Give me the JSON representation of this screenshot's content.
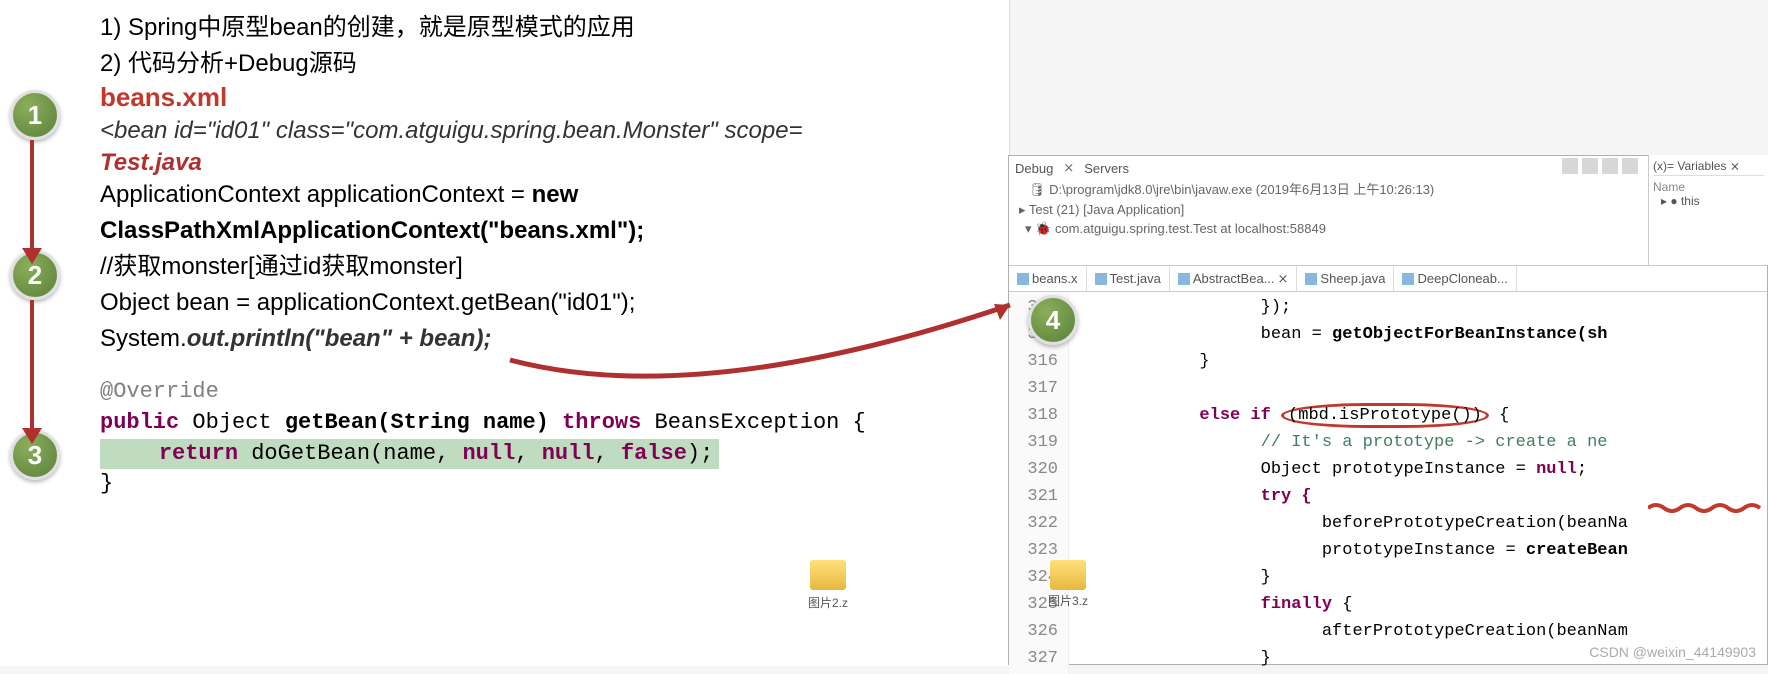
{
  "intro": {
    "line1": "1)  Spring中原型bean的创建，就是原型模式的应用",
    "line2": "2)  代码分析+Debug源码"
  },
  "beans_xml": {
    "title": "beans.xml",
    "content_prefix": "<bean id=",
    "id_val": "\"id01\"",
    "class_attr": " class=",
    "class_val": "\"com.atguigu.spring.bean.Monster\"",
    "scope_attr": " scope=",
    "scope_cut": "\"......\""
  },
  "test_java": {
    "title": "Test.java",
    "line1_a": "ApplicationContext  applicationContext = ",
    "line1_b": "new",
    "line2": "ClassPathXmlApplicationContext(\"beans.xml\");",
    "comment": "//获取monster[通过id获取monster]",
    "line3": "Object bean = applicationContext.getBean(\"id01\");",
    "line4a": "System.",
    "line4b": "out.println(\"bean\" + bean);"
  },
  "getbean": {
    "anno": "@Override",
    "sig_public": "public",
    "sig_obj": " Object ",
    "sig_name": "getBean(String name)",
    "sig_throws": " throws ",
    "sig_exc": "BeansException {",
    "ret_kw": "return",
    "ret_call": " doGetBean(name, ",
    "ret_null1": "null",
    "ret_c1": ", ",
    "ret_null2": "null",
    "ret_c2": ", ",
    "ret_false": "false",
    "ret_end": ");",
    "close": "}"
  },
  "badges": {
    "1": "1",
    "2": "2",
    "3": "3",
    "4": "4"
  },
  "debug": {
    "tab_debug": "Debug",
    "tab_servers": "Servers",
    "proc": "D:\\program\\jdk8.0\\jre\\bin\\javaw.exe (2019年6月13日 上午10:26:13)",
    "app": "Test (21) [Java Application]",
    "thread": "com.atguigu.spring.test.Test at localhost:58849"
  },
  "ftabs": {
    "beans": "beans.x",
    "test": "Test.java",
    "abstract": "AbstractBea...",
    "sheep": "Sheep.java",
    "deep": "DeepCloneab..."
  },
  "editor": {
    "lines": [
      "314",
      "315",
      "316",
      "317",
      "318",
      "319",
      "320",
      "321",
      "322",
      "323",
      "324",
      "325",
      "326",
      "327"
    ],
    "r314": "                  });",
    "r315a": "                  bean = ",
    "r315b": "getObjectForBeanInstance(sh",
    "r316": "            }",
    "r317": "",
    "r318a": "            else if ",
    "r318b": "(mbd.isPrototype())",
    "r318c": " {",
    "r319": "                  // It's a prototype -> create a ne",
    "r320a": "                  Object prototypeInstance = ",
    "r320b": "null",
    "r320c": ";",
    "r321": "                  try {",
    "r322": "                        beforePrototypeCreation(beanNa",
    "r323a": "                        prototypeInstance = ",
    "r323b": "createBean",
    "r324": "                  }",
    "r325a": "                  finally",
    "r325b": " {",
    "r326": "                        afterPrototypeCreation(beanNam",
    "r327": "                  }"
  },
  "vars": {
    "title": "Variables",
    "name": "Name",
    "this": "this"
  },
  "folders": {
    "f2": "图片2.z",
    "f3": "图片3.z"
  },
  "watermark": "CSDN @weixin_44149903"
}
